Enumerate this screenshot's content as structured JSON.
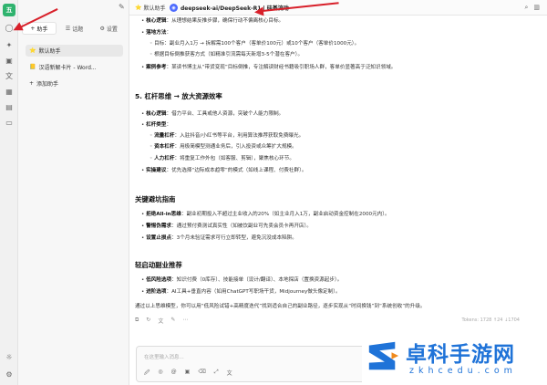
{
  "rail": {
    "avatar_letter": "五",
    "icons": [
      "chat-icon",
      "sparkle-icon",
      "image-icon",
      "translate-icon",
      "apps-icon",
      "doc-icon",
      "folder-icon",
      "sun-icon",
      "settings-icon"
    ]
  },
  "sidebar": {
    "tabs": [
      {
        "label": "助手",
        "icon": "+"
      },
      {
        "label": "话题",
        "icon": "☰"
      },
      {
        "label": "设置",
        "icon": "⚙"
      }
    ],
    "items": [
      {
        "label": "默认助手",
        "icon": "⭐"
      },
      {
        "label": "汉语新解卡片 - Word...",
        "icon": "📒"
      },
      {
        "label": "添加助手",
        "icon": "+"
      }
    ]
  },
  "topbar": {
    "assistant_label": "默认助手",
    "model_label": "deepseek-ai/DeepSeek-R1 | 硅基流动"
  },
  "content": {
    "sec4": [
      {
        "bold": "核心逻辑",
        "text": "：从理想结果反推步骤，确保行动不偏离核心目标。"
      },
      {
        "bold": "落地方法",
        "text": "："
      },
      {
        "bold": "",
        "text": "目标：副业月入1万 → 拆解需100个客户（客单价100元）或10个客户（客单价1000元）。"
      },
      {
        "bold": "",
        "text": "根据目标倒推获客方式（如精准引流需每天新增3-5个潜在客户）。"
      },
      {
        "bold": "案例参考",
        "text": "：某读书博主从“带货变现”目标倒推，专注解读财经书籍吸引职场人群，客单价显著高于泛知识领域。"
      }
    ],
    "sec5_title": "5. 杠杆思维 → 放大资源效率",
    "sec5": [
      {
        "bold": "核心逻辑",
        "text": "：借力平台、工具或他人资源，突破个人能力限制。"
      },
      {
        "bold": "杠杆类型",
        "text": "："
      },
      {
        "bold": "流量杠杆",
        "text": "：入驻抖音/小红书等平台，利用算法推荐获取免费曝光。"
      },
      {
        "bold": "资本杠杆",
        "text": "：用极简模型测通业务后，引入投资或众筹扩大规模。"
      },
      {
        "bold": "人力杠杆",
        "text": "：将重复工作外包（如客服、剪辑），聚焦核心环节。"
      },
      {
        "bold": "实操建议",
        "text": "：优先选择“边际成本趋零”的模式（如线上课程、付费社群）。"
      }
    ],
    "sec6_title": "关键避坑指南",
    "sec6": [
      {
        "bold": "拒绝All-in思维",
        "text": "：副业初期投入不超过主业收入的20%（如主业月入1万，副业启动资金控制在2000元内）。"
      },
      {
        "bold": "警惕伪需求",
        "text": "：通过预付费测试真实性（如被饮副业可先卖会员卡再开店）。"
      },
      {
        "bold": "设置止损点",
        "text": "：3个月未验证需求可行立即转型，避免沉没成本陷阱。"
      }
    ],
    "sec7_title": "轻启动副业推荐",
    "sec7": [
      {
        "bold": "低风险选项",
        "text": "：知识付费（0库存）、技能接单（设计/翻译）、本地探店（置换资源起步）。"
      },
      {
        "bold": "进阶选项",
        "text": "：AI工具+垂直内容（如用ChatGPT写职场干货，Midjourney做头像定制）。"
      }
    ],
    "summary": "通过以上思维模型，你可以用“低风险试错+高精度迭代”找到适合自己的副业路径，逐步实现从“时间换钱”到“系统创收”的升级。"
  },
  "footer": {
    "action_icons": [
      "copy-icon",
      "refresh-icon",
      "translate-icon",
      "edit-icon",
      "more-icon"
    ],
    "tokens": "Tokens: 1728 ↑24 ↓1704",
    "input_placeholder": "在这里输入消息...",
    "tool_icons": [
      "attach-icon",
      "web-icon",
      "at-icon",
      "image-icon",
      "clear-icon",
      "expand-icon",
      "translate-icon"
    ]
  },
  "watermark": {
    "title": "卓科手游网",
    "url": "zkhcedu.com"
  },
  "colors": {
    "accent": "#1f73d8",
    "arrow": "#d8202a",
    "avatar": "#2fb36e"
  }
}
